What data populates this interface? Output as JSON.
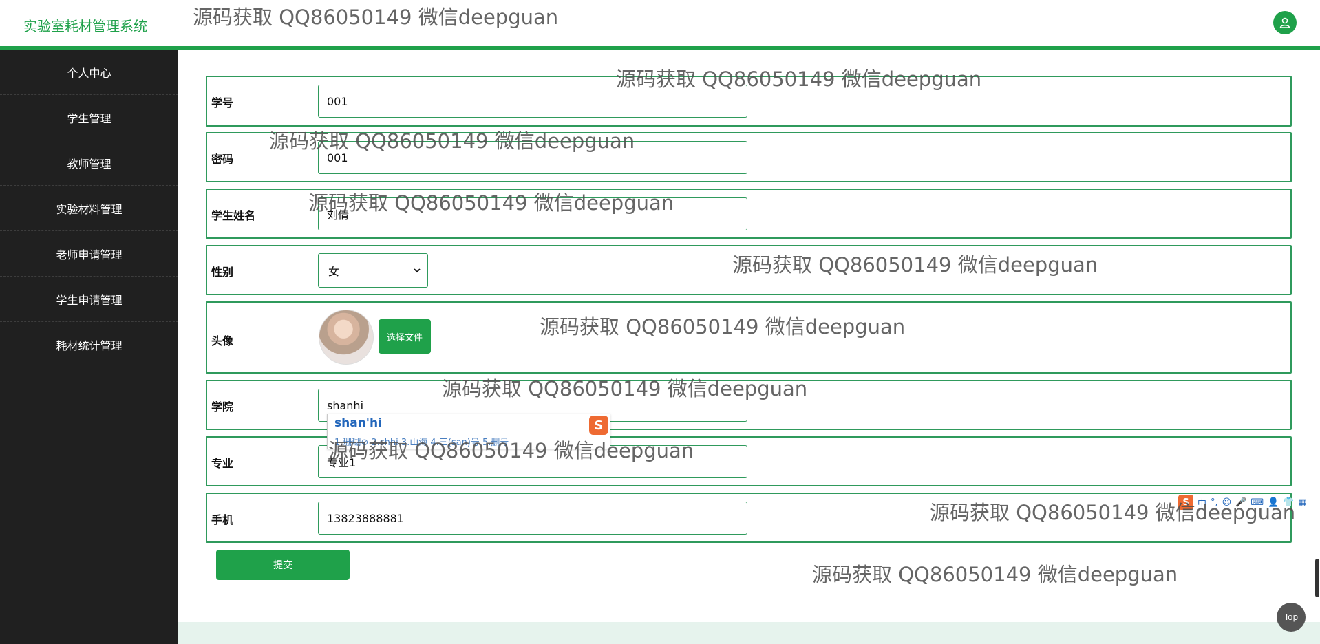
{
  "app": {
    "title": "实验室耗材管理系统"
  },
  "sidebar": {
    "items": [
      {
        "label": "个人中心"
      },
      {
        "label": "学生管理"
      },
      {
        "label": "教师管理"
      },
      {
        "label": "实验材料管理"
      },
      {
        "label": "老师申请管理"
      },
      {
        "label": "学生申请管理"
      },
      {
        "label": "耗材统计管理"
      }
    ]
  },
  "form": {
    "student_id": {
      "label": "学号",
      "value": "001"
    },
    "password": {
      "label": "密码",
      "value": "001"
    },
    "name": {
      "label": "学生姓名",
      "value": "刘倩"
    },
    "gender": {
      "label": "性别",
      "value": "女"
    },
    "avatar": {
      "label": "头像",
      "button": "选择文件"
    },
    "college": {
      "label": "学院",
      "value": "shanhi"
    },
    "major": {
      "label": "专业",
      "value": "专业1"
    },
    "phone": {
      "label": "手机",
      "value": "13823888881"
    },
    "submit": "提交"
  },
  "ime": {
    "composition": "shan'hi",
    "candidates": "1.珊瑚⊘ 2.shhi 3.山海 4.三(san)号 5.删号",
    "logo": "S"
  },
  "ime_toolbar": {
    "logo": "S",
    "lang": "中"
  },
  "watermark": "源码获取 QQ86050149 微信deepguan",
  "top_button": "Top"
}
